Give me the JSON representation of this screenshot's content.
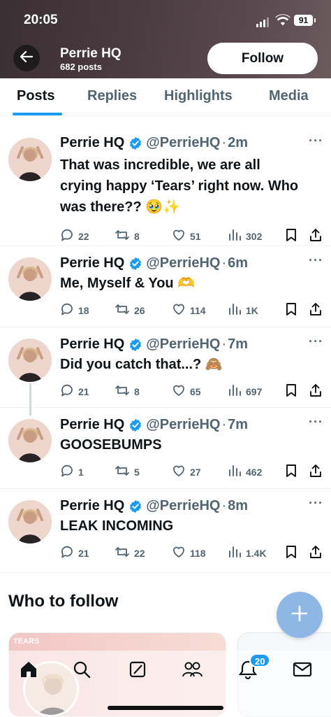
{
  "status_bar": {
    "time": "20:05",
    "battery": "91"
  },
  "header": {
    "name": "Perrie HQ",
    "post_count": "682 posts",
    "follow_label": "Follow"
  },
  "tabs": [
    {
      "label": "Posts",
      "active": true
    },
    {
      "label": "Replies",
      "active": false
    },
    {
      "label": "Highlights",
      "active": false
    },
    {
      "label": "Media",
      "active": false
    }
  ],
  "posts": [
    {
      "name": "Perrie HQ",
      "handle": "@PerrieHQ",
      "ago": "2m",
      "text": "That was incredible, we are all crying happy ‘Tears’ right now. Who was there?? 🥹✨",
      "replies": "22",
      "reposts": "8",
      "likes": "51",
      "views": "302"
    },
    {
      "name": "Perrie HQ",
      "handle": "@PerrieHQ",
      "ago": "6m",
      "text": "Me, Myself & You 🫶",
      "replies": "18",
      "reposts": "26",
      "likes": "114",
      "views": "1K"
    },
    {
      "name": "Perrie HQ",
      "handle": "@PerrieHQ",
      "ago": "7m",
      "text": "Did you catch that...? 🙈",
      "replies": "21",
      "reposts": "8",
      "likes": "65",
      "views": "697"
    },
    {
      "name": "Perrie HQ",
      "handle": "@PerrieHQ",
      "ago": "7m",
      "text": "GOOSEBUMPS",
      "replies": "1",
      "reposts": "5",
      "likes": "27",
      "views": "462"
    },
    {
      "name": "Perrie HQ",
      "handle": "@PerrieHQ",
      "ago": "8m",
      "text": "LEAK INCOMING",
      "replies": "21",
      "reposts": "22",
      "likes": "118",
      "views": "1.4K"
    }
  ],
  "who_to_follow": {
    "title": "Who to follow",
    "card_banner_text": "TEARS"
  },
  "notifications_badge": "20",
  "icons": [
    "back-arrow-icon",
    "verified-badge-icon",
    "more-icon",
    "reply-icon",
    "repost-icon",
    "like-icon",
    "views-icon",
    "bookmark-icon",
    "share-icon",
    "compose-plus-icon",
    "home-icon",
    "search-icon",
    "grok-icon",
    "communities-icon",
    "notifications-icon",
    "messages-icon"
  ],
  "colors": {
    "accent": "#1d9bf0",
    "text": "#0f1419",
    "muted": "#536471",
    "fab": "#8fb7e6"
  }
}
